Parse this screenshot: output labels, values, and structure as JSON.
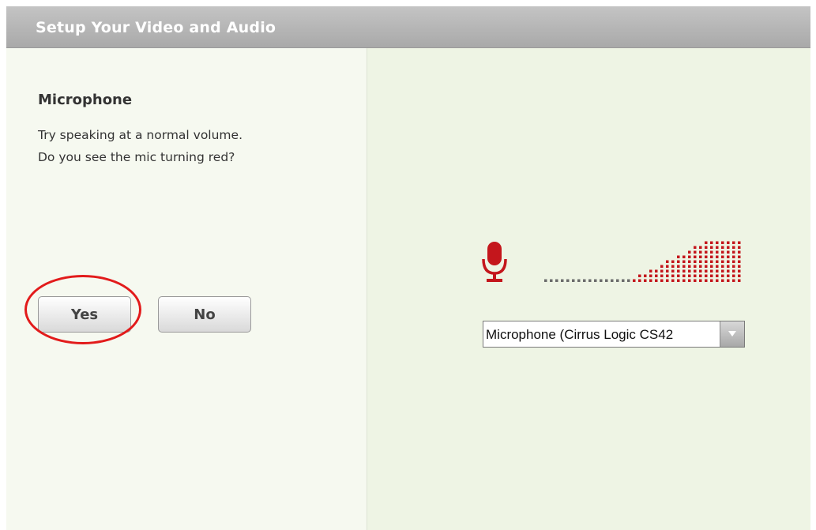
{
  "dialog": {
    "title": "Setup Your Video and Audio"
  },
  "microphone_section": {
    "heading": "Microphone",
    "instruction_line1": "Try speaking at a normal volume.",
    "instruction_line2": "Do you see the mic turning red?",
    "yes_label": "Yes",
    "no_label": "No"
  },
  "device_select": {
    "selected_value": "Microphone (Cirrus Logic CS42"
  },
  "icons": {
    "microphone": "microphone-icon",
    "dropdown": "chevron-down-icon"
  },
  "colors": {
    "mic_active": "#c4161c",
    "meter_inactive": "#6b6b6b",
    "highlight": "#e21b1b",
    "titlebar": "#b3b3b3"
  }
}
